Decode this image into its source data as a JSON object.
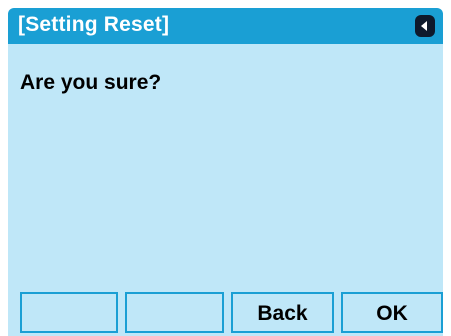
{
  "header": {
    "title": "[Setting Reset]",
    "back_icon": "left-triangle-icon",
    "colors": {
      "title_bar": "#1a9fd4",
      "back_pill": "#0e1a2c"
    }
  },
  "main": {
    "message": "Are you sure?",
    "background": "#bfe7f8"
  },
  "softkeys": [
    {
      "label": ""
    },
    {
      "label": ""
    },
    {
      "label": "Back"
    },
    {
      "label": "OK"
    }
  ]
}
